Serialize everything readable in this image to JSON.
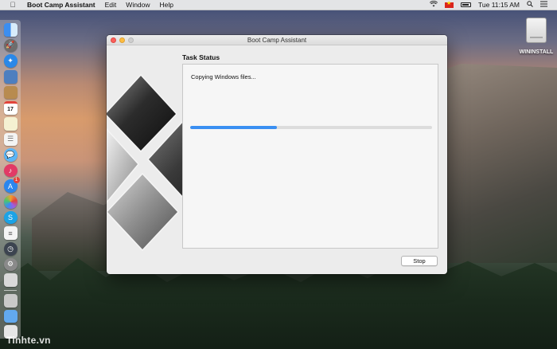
{
  "menubar": {
    "apple_icon": "apple-icon",
    "app_name": "Boot Camp Assistant",
    "menus": [
      "Edit",
      "Window",
      "Help"
    ],
    "clock": "Tue 11:15 AM"
  },
  "dock": {
    "icons": [
      {
        "name": "finder-icon",
        "color": "#3b8ef0"
      },
      {
        "name": "launchpad-icon",
        "color": "#6d6d6d"
      },
      {
        "name": "safari-icon",
        "color": "#2a88e8"
      },
      {
        "name": "preview-icon",
        "color": "#4d7fbf"
      },
      {
        "name": "contacts-icon",
        "color": "#b88b4f"
      },
      {
        "name": "calendar-icon",
        "color": "#ffffff"
      },
      {
        "name": "notes-icon",
        "color": "#f5f1d2"
      },
      {
        "name": "reminders-icon",
        "color": "#f4f4f4"
      },
      {
        "name": "messages-icon",
        "color": "#5bb6f7"
      },
      {
        "name": "itunes-icon",
        "color": "#e23a66"
      },
      {
        "name": "app-store-icon",
        "color": "#2a86ef"
      },
      {
        "name": "photos-icon",
        "color": "#f0a030"
      },
      {
        "name": "skype-icon",
        "color": "#1ba3e6"
      },
      {
        "name": "pages-icon",
        "color": "#f4f4f4"
      },
      {
        "name": "time-machine-icon",
        "color": "#3c4450"
      },
      {
        "name": "system-preferences-icon",
        "color": "#8a8a8a"
      },
      {
        "name": "disk-utility-icon",
        "color": "#d9d9d9"
      },
      {
        "name": "boot-camp-icon",
        "color": "#c9c9c9"
      },
      {
        "name": "downloads-folder-icon",
        "color": "#62a9ee"
      },
      {
        "name": "trash-icon",
        "color": "#e6e6e6"
      }
    ],
    "calendar_day": "17",
    "badge_count": "1"
  },
  "desktop": {
    "volume_label": "WININSTALL"
  },
  "window": {
    "title": "Boot Camp Assistant",
    "section_title": "Task Status",
    "status_text": "Copying Windows files...",
    "progress_percent": 36,
    "stop_label": "Stop"
  },
  "watermark": "Tinhte.vn",
  "colors": {
    "accent": "#3a8ff2",
    "close": "#fc605b",
    "minimize": "#fdbc40"
  }
}
